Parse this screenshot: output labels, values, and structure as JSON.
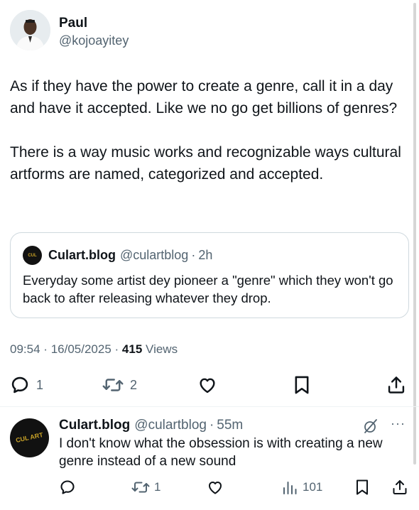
{
  "tweet": {
    "author": {
      "display_name": "Paul",
      "handle": "@kojoayitey",
      "avatar_icon": "profile-photo"
    },
    "text_paragraphs": [
      "As if they have the power to create a genre, call it in a day and have it accepted. Like we no go get billions of genres?",
      "There is a way music works and recognizable ways cultural artforms are named, categorized and accepted."
    ],
    "quote": {
      "display_name": "Culart.blog",
      "handle": "@culartblog",
      "separator": "·",
      "time": "2h",
      "text": "Everyday some artist dey pioneer a \"genre\" which they won't go back to after releasing whatever they drop."
    },
    "meta": {
      "time": "09:54",
      "separator": "·",
      "date": "16/05/2025",
      "views_count": "415",
      "views_label": "Views"
    },
    "actions": {
      "reply_count": "1",
      "retweet_count": "2"
    }
  },
  "reply": {
    "display_name": "Culart.blog",
    "handle": "@culartblog",
    "separator": "·",
    "time": "55m",
    "avatar_text": "CUL ART",
    "text": "I don't know what the obsession is with creating a new genre instead of a new sound",
    "actions": {
      "retweet_count": "1",
      "views_count": "101"
    },
    "more_label": "···"
  },
  "colors": {
    "text": "#0f1419",
    "secondary": "#536471",
    "border": "#cfd9de",
    "logo_gold": "#c9a227"
  }
}
